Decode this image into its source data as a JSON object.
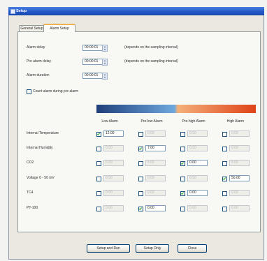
{
  "window": {
    "title": "Setup"
  },
  "tabs": [
    {
      "label": "General Setup",
      "active": false
    },
    {
      "label": "Alarm Setup",
      "active": true
    }
  ],
  "delays": [
    {
      "label": "Alarm delay",
      "value": "00:00:01",
      "note": "(depends on the sampling interval)"
    },
    {
      "label": "Pre alarm delay",
      "value": "00:00:01",
      "note": "(depends on the sampling interval)"
    },
    {
      "label": "Alarm duration",
      "value": "00:00:01"
    }
  ],
  "count_prealarm": {
    "label": "Count alarm during pre alarm",
    "checked": false
  },
  "alarm_table": {
    "gradient_colors": [
      "#1f3f7a",
      "#6fa8de",
      "#f4b07a",
      "#df4319"
    ],
    "columns": [
      "Low Alarm",
      "Pre-low Alarm",
      "Pre-high Alarm",
      "High Alarm"
    ],
    "rows": [
      {
        "label": "Internal Temperature",
        "cells": [
          {
            "checked": true,
            "value": "12.00"
          },
          {
            "checked": false,
            "value": "0.00"
          },
          {
            "checked": false,
            "value": "0.00"
          },
          {
            "checked": false,
            "value": "0.00"
          }
        ]
      },
      {
        "label": "Internal Humidity",
        "cells": [
          {
            "checked": false,
            "value": "0.00"
          },
          {
            "checked": true,
            "value": "7.00"
          },
          {
            "checked": false,
            "value": "0.00"
          },
          {
            "checked": false,
            "value": "0.00"
          }
        ]
      },
      {
        "label": "CO2",
        "cells": [
          {
            "checked": false,
            "value": "0.00"
          },
          {
            "checked": false,
            "value": "0.00"
          },
          {
            "checked": true,
            "value": "0.00"
          },
          {
            "checked": false,
            "value": "0.00"
          }
        ]
      },
      {
        "label": "Voltage 0 - 50 mV",
        "cells": [
          {
            "checked": false,
            "value": "0.00"
          },
          {
            "checked": false,
            "value": "0.00"
          },
          {
            "checked": false,
            "value": "0.00"
          },
          {
            "checked": true,
            "value": "50.00"
          }
        ]
      },
      {
        "label": "TC4",
        "cells": [
          {
            "checked": false,
            "value": "0.00"
          },
          {
            "checked": false,
            "value": "0.00"
          },
          {
            "checked": true,
            "value": "0.00"
          },
          {
            "checked": false,
            "value": "0.00"
          }
        ]
      },
      {
        "label": "PT-100",
        "cells": [
          {
            "checked": false,
            "value": "0.00"
          },
          {
            "checked": true,
            "value": "0.00"
          },
          {
            "checked": false,
            "value": "0.00"
          },
          {
            "checked": false,
            "value": "0.00"
          }
        ]
      }
    ]
  },
  "buttons": {
    "setup_run": "Setup and Run",
    "setup_only": "Setup Only",
    "close": "Close"
  }
}
